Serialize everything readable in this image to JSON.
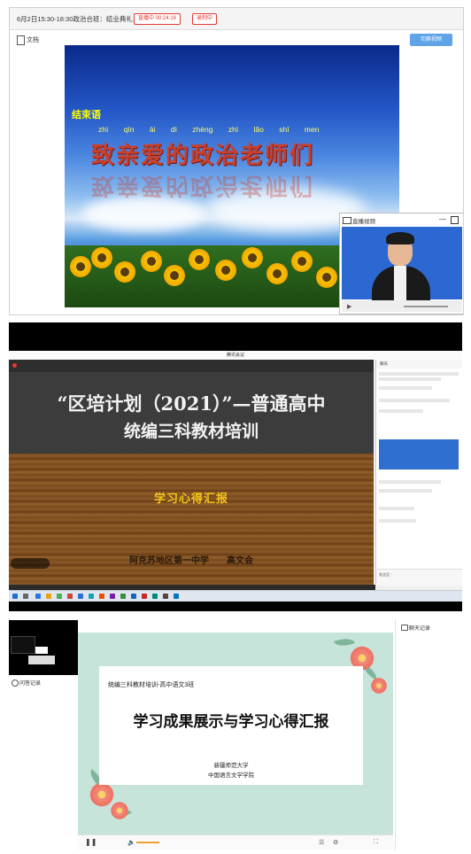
{
  "panel1": {
    "title": "6月2日15:30-18:30政治合班：结业典礼",
    "live_badge": "直播中 00:24:16",
    "rec_badge": "录制中",
    "doc_label": "文档",
    "switch_button": "切换视频",
    "slide": {
      "label": "结束语",
      "pinyin": "zhì qīn ài dì zhèng zhì lǎo shī men",
      "headline": "致亲爱的政治老师们"
    },
    "live_window_title": "直播视频"
  },
  "panel2": {
    "window_title": "腾讯会议",
    "slide": {
      "title_line1": "“区培计划（2021）”—普通高中",
      "title_line2": "统编三科教材培训",
      "subtitle": "学习心得汇报",
      "affiliation": "阿克苏地区第一中学　　高文会"
    },
    "chat": {
      "header": "聊天"
    },
    "chat_placeholder": "发送至："
  },
  "panel3": {
    "qa_label": "问答记录",
    "chat_title": "聊天记录",
    "slide": {
      "class_label": "统编三科教材培训-高中语文3班",
      "heading": "学习成果展示与学习心得汇报",
      "university": "新疆师范大学",
      "college": "中国语言文学学院"
    }
  },
  "icons": {
    "doc": "document-icon",
    "camera": "camera-icon",
    "minimize": "minimize-icon",
    "maximize": "maximize-icon",
    "pause": "pause-icon",
    "volume": "volume-icon",
    "chat": "chat-icon",
    "qa": "qa-icon"
  },
  "colors": {
    "live_red": "#e53935",
    "switch_blue": "#5ea4e6",
    "headline_red": "#c8402e",
    "subtitle_yellow": "#f3c51b",
    "slide_green": "#c7e4da"
  }
}
